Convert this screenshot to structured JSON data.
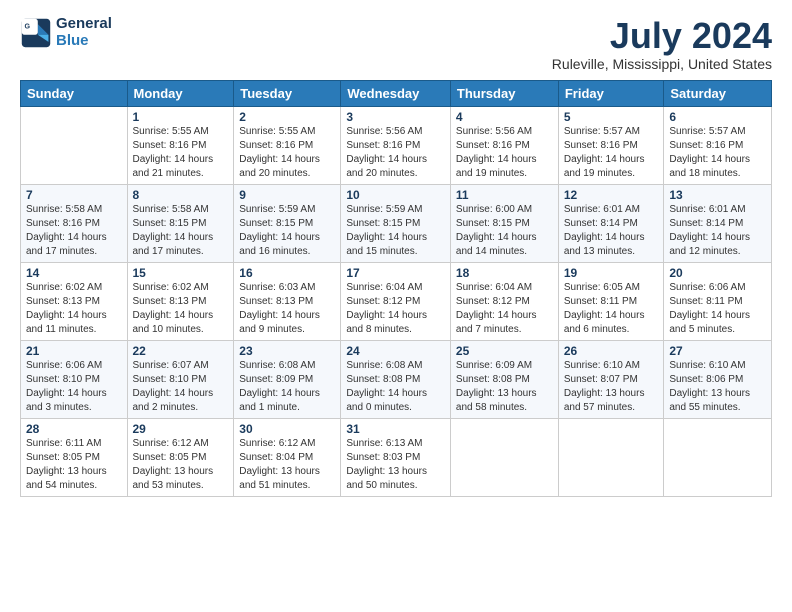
{
  "logo": {
    "general": "General",
    "blue": "Blue"
  },
  "title": "July 2024",
  "subtitle": "Ruleville, Mississippi, United States",
  "days_of_week": [
    "Sunday",
    "Monday",
    "Tuesday",
    "Wednesday",
    "Thursday",
    "Friday",
    "Saturday"
  ],
  "weeks": [
    [
      {
        "num": "",
        "info": ""
      },
      {
        "num": "1",
        "info": "Sunrise: 5:55 AM\nSunset: 8:16 PM\nDaylight: 14 hours\nand 21 minutes."
      },
      {
        "num": "2",
        "info": "Sunrise: 5:55 AM\nSunset: 8:16 PM\nDaylight: 14 hours\nand 20 minutes."
      },
      {
        "num": "3",
        "info": "Sunrise: 5:56 AM\nSunset: 8:16 PM\nDaylight: 14 hours\nand 20 minutes."
      },
      {
        "num": "4",
        "info": "Sunrise: 5:56 AM\nSunset: 8:16 PM\nDaylight: 14 hours\nand 19 minutes."
      },
      {
        "num": "5",
        "info": "Sunrise: 5:57 AM\nSunset: 8:16 PM\nDaylight: 14 hours\nand 19 minutes."
      },
      {
        "num": "6",
        "info": "Sunrise: 5:57 AM\nSunset: 8:16 PM\nDaylight: 14 hours\nand 18 minutes."
      }
    ],
    [
      {
        "num": "7",
        "info": "Sunrise: 5:58 AM\nSunset: 8:16 PM\nDaylight: 14 hours\nand 17 minutes."
      },
      {
        "num": "8",
        "info": "Sunrise: 5:58 AM\nSunset: 8:15 PM\nDaylight: 14 hours\nand 17 minutes."
      },
      {
        "num": "9",
        "info": "Sunrise: 5:59 AM\nSunset: 8:15 PM\nDaylight: 14 hours\nand 16 minutes."
      },
      {
        "num": "10",
        "info": "Sunrise: 5:59 AM\nSunset: 8:15 PM\nDaylight: 14 hours\nand 15 minutes."
      },
      {
        "num": "11",
        "info": "Sunrise: 6:00 AM\nSunset: 8:15 PM\nDaylight: 14 hours\nand 14 minutes."
      },
      {
        "num": "12",
        "info": "Sunrise: 6:01 AM\nSunset: 8:14 PM\nDaylight: 14 hours\nand 13 minutes."
      },
      {
        "num": "13",
        "info": "Sunrise: 6:01 AM\nSunset: 8:14 PM\nDaylight: 14 hours\nand 12 minutes."
      }
    ],
    [
      {
        "num": "14",
        "info": "Sunrise: 6:02 AM\nSunset: 8:13 PM\nDaylight: 14 hours\nand 11 minutes."
      },
      {
        "num": "15",
        "info": "Sunrise: 6:02 AM\nSunset: 8:13 PM\nDaylight: 14 hours\nand 10 minutes."
      },
      {
        "num": "16",
        "info": "Sunrise: 6:03 AM\nSunset: 8:13 PM\nDaylight: 14 hours\nand 9 minutes."
      },
      {
        "num": "17",
        "info": "Sunrise: 6:04 AM\nSunset: 8:12 PM\nDaylight: 14 hours\nand 8 minutes."
      },
      {
        "num": "18",
        "info": "Sunrise: 6:04 AM\nSunset: 8:12 PM\nDaylight: 14 hours\nand 7 minutes."
      },
      {
        "num": "19",
        "info": "Sunrise: 6:05 AM\nSunset: 8:11 PM\nDaylight: 14 hours\nand 6 minutes."
      },
      {
        "num": "20",
        "info": "Sunrise: 6:06 AM\nSunset: 8:11 PM\nDaylight: 14 hours\nand 5 minutes."
      }
    ],
    [
      {
        "num": "21",
        "info": "Sunrise: 6:06 AM\nSunset: 8:10 PM\nDaylight: 14 hours\nand 3 minutes."
      },
      {
        "num": "22",
        "info": "Sunrise: 6:07 AM\nSunset: 8:10 PM\nDaylight: 14 hours\nand 2 minutes."
      },
      {
        "num": "23",
        "info": "Sunrise: 6:08 AM\nSunset: 8:09 PM\nDaylight: 14 hours\nand 1 minute."
      },
      {
        "num": "24",
        "info": "Sunrise: 6:08 AM\nSunset: 8:08 PM\nDaylight: 14 hours\nand 0 minutes."
      },
      {
        "num": "25",
        "info": "Sunrise: 6:09 AM\nSunset: 8:08 PM\nDaylight: 13 hours\nand 58 minutes."
      },
      {
        "num": "26",
        "info": "Sunrise: 6:10 AM\nSunset: 8:07 PM\nDaylight: 13 hours\nand 57 minutes."
      },
      {
        "num": "27",
        "info": "Sunrise: 6:10 AM\nSunset: 8:06 PM\nDaylight: 13 hours\nand 55 minutes."
      }
    ],
    [
      {
        "num": "28",
        "info": "Sunrise: 6:11 AM\nSunset: 8:05 PM\nDaylight: 13 hours\nand 54 minutes."
      },
      {
        "num": "29",
        "info": "Sunrise: 6:12 AM\nSunset: 8:05 PM\nDaylight: 13 hours\nand 53 minutes."
      },
      {
        "num": "30",
        "info": "Sunrise: 6:12 AM\nSunset: 8:04 PM\nDaylight: 13 hours\nand 51 minutes."
      },
      {
        "num": "31",
        "info": "Sunrise: 6:13 AM\nSunset: 8:03 PM\nDaylight: 13 hours\nand 50 minutes."
      },
      {
        "num": "",
        "info": ""
      },
      {
        "num": "",
        "info": ""
      },
      {
        "num": "",
        "info": ""
      }
    ]
  ]
}
